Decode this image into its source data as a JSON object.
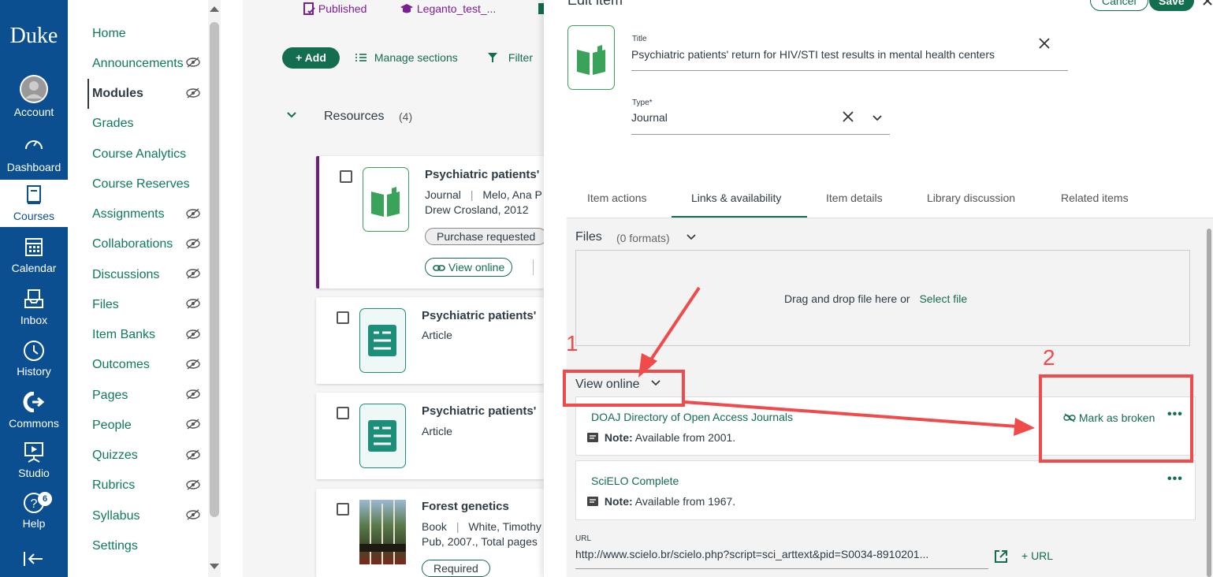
{
  "global_nav": {
    "logo": "Duke",
    "items": [
      {
        "label": "Account",
        "icon": "account-icon"
      },
      {
        "label": "Dashboard",
        "icon": "dashboard-icon"
      },
      {
        "label": "Courses",
        "icon": "courses-icon"
      },
      {
        "label": "Calendar",
        "icon": "calendar-icon"
      },
      {
        "label": "Inbox",
        "icon": "inbox-icon"
      },
      {
        "label": "History",
        "icon": "history-icon"
      },
      {
        "label": "Commons",
        "icon": "commons-icon"
      },
      {
        "label": "Studio",
        "icon": "studio-icon"
      },
      {
        "label": "Help",
        "icon": "help-icon",
        "badge": "6"
      }
    ]
  },
  "course_nav": {
    "items": [
      {
        "label": "Home"
      },
      {
        "label": "Announcements"
      },
      {
        "label": "Modules"
      },
      {
        "label": "Grades"
      },
      {
        "label": "Course Analytics"
      },
      {
        "label": "Course Reserves"
      },
      {
        "label": "Assignments"
      },
      {
        "label": "Collaborations"
      },
      {
        "label": "Discussions"
      },
      {
        "label": "Files"
      },
      {
        "label": "Item Banks"
      },
      {
        "label": "Outcomes"
      },
      {
        "label": "Pages"
      },
      {
        "label": "People"
      },
      {
        "label": "Quizzes"
      },
      {
        "label": "Rubrics"
      },
      {
        "label": "Syllabus"
      },
      {
        "label": "Settings"
      }
    ]
  },
  "topbar": {
    "published": "Published",
    "course": "Leganto_test_..."
  },
  "toolbar": {
    "add": "+ Add",
    "manage_sections": "Manage sections",
    "filter": "Filter"
  },
  "section": {
    "title": "Resources",
    "count": "(4)"
  },
  "cards": [
    {
      "title": "Psychiatric patients'",
      "type": "Journal",
      "authors": "Melo, Ana P",
      "extra": "Drew Crosland, 2012",
      "tag": "Purchase requested",
      "action": "View online"
    },
    {
      "title": "Psychiatric patients'",
      "type": "Article"
    },
    {
      "title": "Psychiatric patients'",
      "type": "Article"
    },
    {
      "title": "Forest genetics",
      "type": "Book",
      "authors": "White, Timothy",
      "extra": "Pub, 2007., Total pages",
      "tag": "Required"
    }
  ],
  "panel": {
    "header": "Edit item",
    "cancel": "Cancel",
    "save": "Save",
    "title_label": "Title",
    "title_value": "Psychiatric patients' return for HIV/STI test results in mental health centers",
    "type_label": "Type*",
    "type_value": "Journal",
    "tabs": [
      "Item actions",
      "Links & availability",
      "Item details",
      "Library discussion",
      "Related items"
    ],
    "files_label": "Files",
    "files_count": "(0 formats)",
    "drop_text": "Drag and drop file here or",
    "select_file": "Select file",
    "view_online": "View online",
    "links": [
      {
        "name": "DOAJ Directory of Open Access Journals",
        "note_label": "Note:",
        "note": "Available from 2001.",
        "action": "Mark as broken"
      },
      {
        "name": "SciELO Complete",
        "note_label": "Note:",
        "note": "Available from 1967."
      }
    ],
    "url_label": "URL",
    "url_value": "http://www.scielo.br/scielo.php?script=sci_arttext&pid=S0034-8910201...",
    "add_url": "+ URL"
  },
  "annotations": {
    "one": "1",
    "two": "2"
  },
  "colors": {
    "nav_bg": "#0b4f91",
    "accent": "#136d4f",
    "annotation": "#f04a4a"
  }
}
